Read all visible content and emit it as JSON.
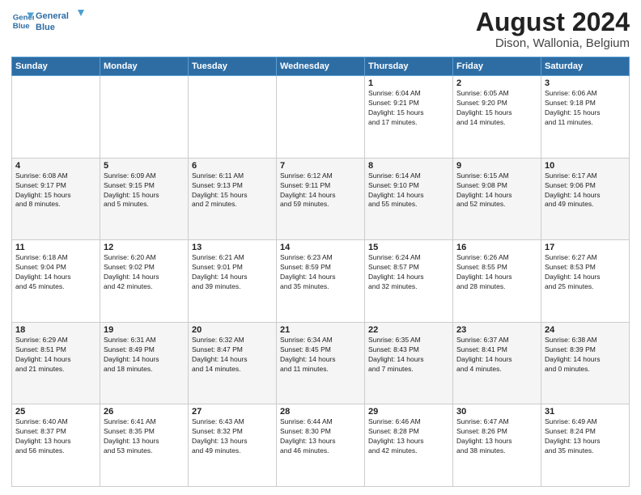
{
  "header": {
    "logo_line1": "General",
    "logo_line2": "Blue",
    "title": "August 2024",
    "subtitle": "Dison, Wallonia, Belgium"
  },
  "days_of_week": [
    "Sunday",
    "Monday",
    "Tuesday",
    "Wednesday",
    "Thursday",
    "Friday",
    "Saturday"
  ],
  "weeks": [
    [
      {
        "day": "",
        "info": ""
      },
      {
        "day": "",
        "info": ""
      },
      {
        "day": "",
        "info": ""
      },
      {
        "day": "",
        "info": ""
      },
      {
        "day": "1",
        "info": "Sunrise: 6:04 AM\nSunset: 9:21 PM\nDaylight: 15 hours\nand 17 minutes."
      },
      {
        "day": "2",
        "info": "Sunrise: 6:05 AM\nSunset: 9:20 PM\nDaylight: 15 hours\nand 14 minutes."
      },
      {
        "day": "3",
        "info": "Sunrise: 6:06 AM\nSunset: 9:18 PM\nDaylight: 15 hours\nand 11 minutes."
      }
    ],
    [
      {
        "day": "4",
        "info": "Sunrise: 6:08 AM\nSunset: 9:17 PM\nDaylight: 15 hours\nand 8 minutes."
      },
      {
        "day": "5",
        "info": "Sunrise: 6:09 AM\nSunset: 9:15 PM\nDaylight: 15 hours\nand 5 minutes."
      },
      {
        "day": "6",
        "info": "Sunrise: 6:11 AM\nSunset: 9:13 PM\nDaylight: 15 hours\nand 2 minutes."
      },
      {
        "day": "7",
        "info": "Sunrise: 6:12 AM\nSunset: 9:11 PM\nDaylight: 14 hours\nand 59 minutes."
      },
      {
        "day": "8",
        "info": "Sunrise: 6:14 AM\nSunset: 9:10 PM\nDaylight: 14 hours\nand 55 minutes."
      },
      {
        "day": "9",
        "info": "Sunrise: 6:15 AM\nSunset: 9:08 PM\nDaylight: 14 hours\nand 52 minutes."
      },
      {
        "day": "10",
        "info": "Sunrise: 6:17 AM\nSunset: 9:06 PM\nDaylight: 14 hours\nand 49 minutes."
      }
    ],
    [
      {
        "day": "11",
        "info": "Sunrise: 6:18 AM\nSunset: 9:04 PM\nDaylight: 14 hours\nand 45 minutes."
      },
      {
        "day": "12",
        "info": "Sunrise: 6:20 AM\nSunset: 9:02 PM\nDaylight: 14 hours\nand 42 minutes."
      },
      {
        "day": "13",
        "info": "Sunrise: 6:21 AM\nSunset: 9:01 PM\nDaylight: 14 hours\nand 39 minutes."
      },
      {
        "day": "14",
        "info": "Sunrise: 6:23 AM\nSunset: 8:59 PM\nDaylight: 14 hours\nand 35 minutes."
      },
      {
        "day": "15",
        "info": "Sunrise: 6:24 AM\nSunset: 8:57 PM\nDaylight: 14 hours\nand 32 minutes."
      },
      {
        "day": "16",
        "info": "Sunrise: 6:26 AM\nSunset: 8:55 PM\nDaylight: 14 hours\nand 28 minutes."
      },
      {
        "day": "17",
        "info": "Sunrise: 6:27 AM\nSunset: 8:53 PM\nDaylight: 14 hours\nand 25 minutes."
      }
    ],
    [
      {
        "day": "18",
        "info": "Sunrise: 6:29 AM\nSunset: 8:51 PM\nDaylight: 14 hours\nand 21 minutes."
      },
      {
        "day": "19",
        "info": "Sunrise: 6:31 AM\nSunset: 8:49 PM\nDaylight: 14 hours\nand 18 minutes."
      },
      {
        "day": "20",
        "info": "Sunrise: 6:32 AM\nSunset: 8:47 PM\nDaylight: 14 hours\nand 14 minutes."
      },
      {
        "day": "21",
        "info": "Sunrise: 6:34 AM\nSunset: 8:45 PM\nDaylight: 14 hours\nand 11 minutes."
      },
      {
        "day": "22",
        "info": "Sunrise: 6:35 AM\nSunset: 8:43 PM\nDaylight: 14 hours\nand 7 minutes."
      },
      {
        "day": "23",
        "info": "Sunrise: 6:37 AM\nSunset: 8:41 PM\nDaylight: 14 hours\nand 4 minutes."
      },
      {
        "day": "24",
        "info": "Sunrise: 6:38 AM\nSunset: 8:39 PM\nDaylight: 14 hours\nand 0 minutes."
      }
    ],
    [
      {
        "day": "25",
        "info": "Sunrise: 6:40 AM\nSunset: 8:37 PM\nDaylight: 13 hours\nand 56 minutes."
      },
      {
        "day": "26",
        "info": "Sunrise: 6:41 AM\nSunset: 8:35 PM\nDaylight: 13 hours\nand 53 minutes."
      },
      {
        "day": "27",
        "info": "Sunrise: 6:43 AM\nSunset: 8:32 PM\nDaylight: 13 hours\nand 49 minutes."
      },
      {
        "day": "28",
        "info": "Sunrise: 6:44 AM\nSunset: 8:30 PM\nDaylight: 13 hours\nand 46 minutes."
      },
      {
        "day": "29",
        "info": "Sunrise: 6:46 AM\nSunset: 8:28 PM\nDaylight: 13 hours\nand 42 minutes."
      },
      {
        "day": "30",
        "info": "Sunrise: 6:47 AM\nSunset: 8:26 PM\nDaylight: 13 hours\nand 38 minutes."
      },
      {
        "day": "31",
        "info": "Sunrise: 6:49 AM\nSunset: 8:24 PM\nDaylight: 13 hours\nand 35 minutes."
      }
    ]
  ]
}
